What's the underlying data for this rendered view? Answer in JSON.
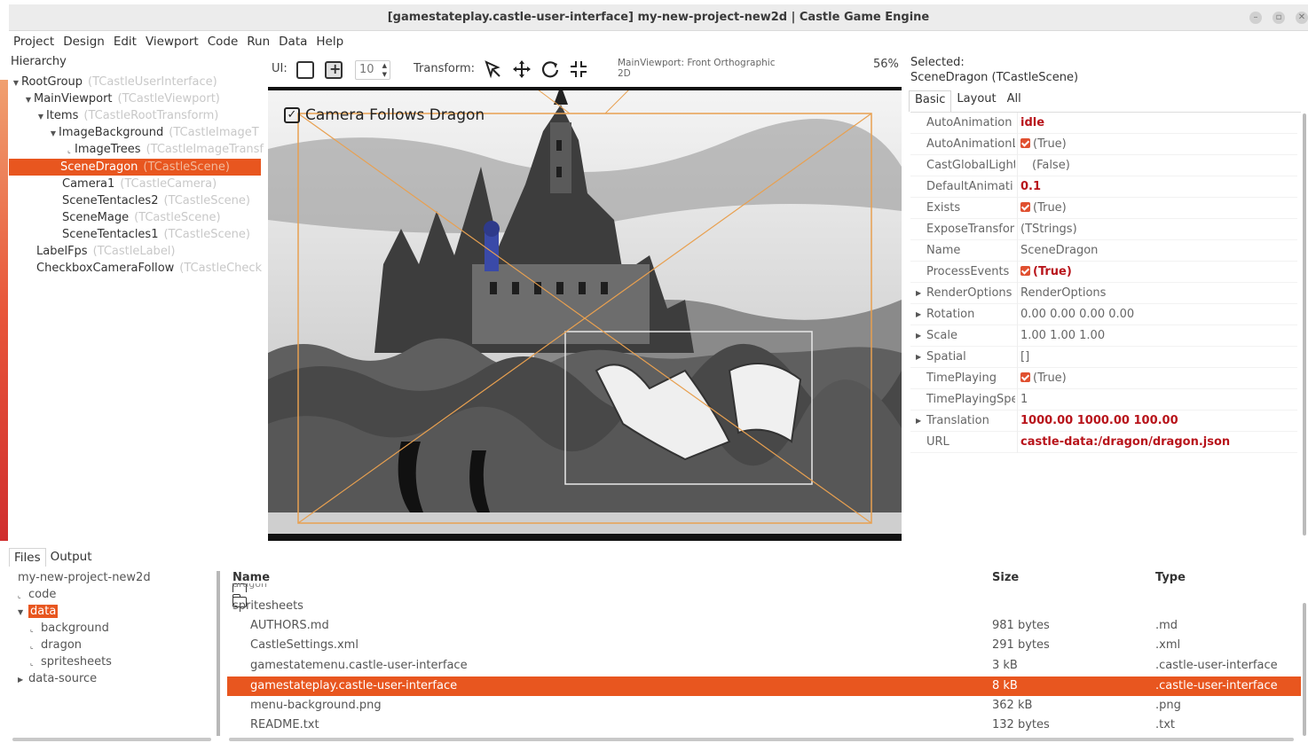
{
  "window": {
    "title": "[gamestateplay.castle-user-interface] my-new-project-new2d | Castle Game Engine"
  },
  "menu": [
    "Project",
    "Design",
    "Edit",
    "Viewport",
    "Code",
    "Run",
    "Data",
    "Help"
  ],
  "hierarchy": {
    "title": "Hierarchy",
    "items": [
      {
        "label": "RootGroup",
        "cls": "(TCastleUserInterface)"
      },
      {
        "label": "MainViewport",
        "cls": "(TCastleViewport)"
      },
      {
        "label": "Items",
        "cls": "(TCastleRootTransform)"
      },
      {
        "label": "ImageBackground",
        "cls": "(TCastleImageT"
      },
      {
        "label": "ImageTrees",
        "cls": "(TCastleImageTransf"
      },
      {
        "label": "SceneDragon",
        "cls": "(TCastleScene)"
      },
      {
        "label": "Camera1",
        "cls": "(TCastleCamera)"
      },
      {
        "label": "SceneTentacles2",
        "cls": "(TCastleScene)"
      },
      {
        "label": "SceneMage",
        "cls": "(TCastleScene)"
      },
      {
        "label": "SceneTentacles1",
        "cls": "(TCastleScene)"
      },
      {
        "label": "LabelFps",
        "cls": "(TCastleLabel)"
      },
      {
        "label": "CheckboxCameraFollow",
        "cls": "(TCastleCheck"
      }
    ]
  },
  "toolbar": {
    "ui_label": "UI:",
    "grid_value": "10",
    "transform_label": "Transform:",
    "viewport_info_line1": "MainViewport: Front Orthographic",
    "viewport_info_line2": "2D",
    "zoom": "56%"
  },
  "viewport": {
    "checkbox_label": "Camera Follows Dragon"
  },
  "inspector": {
    "selected_label": "Selected:",
    "selected_value": "SceneDragon (TCastleScene)",
    "tabs": [
      "Basic",
      "Layout",
      "All"
    ],
    "rows": [
      {
        "name": "AutoAnimation",
        "value": "idle"
      },
      {
        "name": "AutoAnimationL",
        "value": "(True)"
      },
      {
        "name": "CastGlobalLight",
        "value": "(False)"
      },
      {
        "name": "DefaultAnimati",
        "value": "0.1"
      },
      {
        "name": "Exists",
        "value": "(True)"
      },
      {
        "name": "ExposeTransfor",
        "value": "(TStrings)"
      },
      {
        "name": "Name",
        "value": "SceneDragon"
      },
      {
        "name": "ProcessEvents",
        "value": "(True)"
      },
      {
        "name": "RenderOptions",
        "value": "RenderOptions"
      },
      {
        "name": "Rotation",
        "value": "0.00 0.00 0.00 0.00"
      },
      {
        "name": "Scale",
        "value": "1.00 1.00 1.00"
      },
      {
        "name": "Spatial",
        "value": "[]"
      },
      {
        "name": "TimePlaying",
        "value": "(True)"
      },
      {
        "name": "TimePlayingSpe",
        "value": "1"
      },
      {
        "name": "Translation",
        "value": "1000.00 1000.00 100.00"
      },
      {
        "name": "URL",
        "value": "castle-data:/dragon/dragon.json"
      }
    ]
  },
  "bottom_tabs": [
    "Files",
    "Output"
  ],
  "files_tree": [
    {
      "label": "my-new-project-new2d"
    },
    {
      "label": "code"
    },
    {
      "label": "data"
    },
    {
      "label": "background"
    },
    {
      "label": "dragon"
    },
    {
      "label": "spritesheets"
    },
    {
      "label": "data-source"
    }
  ],
  "files_list": {
    "headers": {
      "name": "Name",
      "size": "Size",
      "type": "Type"
    },
    "partial_row": "dragon",
    "rows": [
      {
        "name": "spritesheets",
        "size": "",
        "type": ""
      },
      {
        "name": "AUTHORS.md",
        "size": "981 bytes",
        "type": ".md"
      },
      {
        "name": "CastleSettings.xml",
        "size": "291 bytes",
        "type": ".xml"
      },
      {
        "name": "gamestatemenu.castle-user-interface",
        "size": "3 kB",
        "type": ".castle-user-interface"
      },
      {
        "name": "gamestateplay.castle-user-interface",
        "size": "8 kB",
        "type": ".castle-user-interface"
      },
      {
        "name": "menu-background.png",
        "size": "362 kB",
        "type": ".png"
      },
      {
        "name": "README.txt",
        "size": "132 bytes",
        "type": ".txt"
      }
    ]
  },
  "colors": {
    "accent": "#e8561f",
    "value_bold": "#b8141b"
  }
}
